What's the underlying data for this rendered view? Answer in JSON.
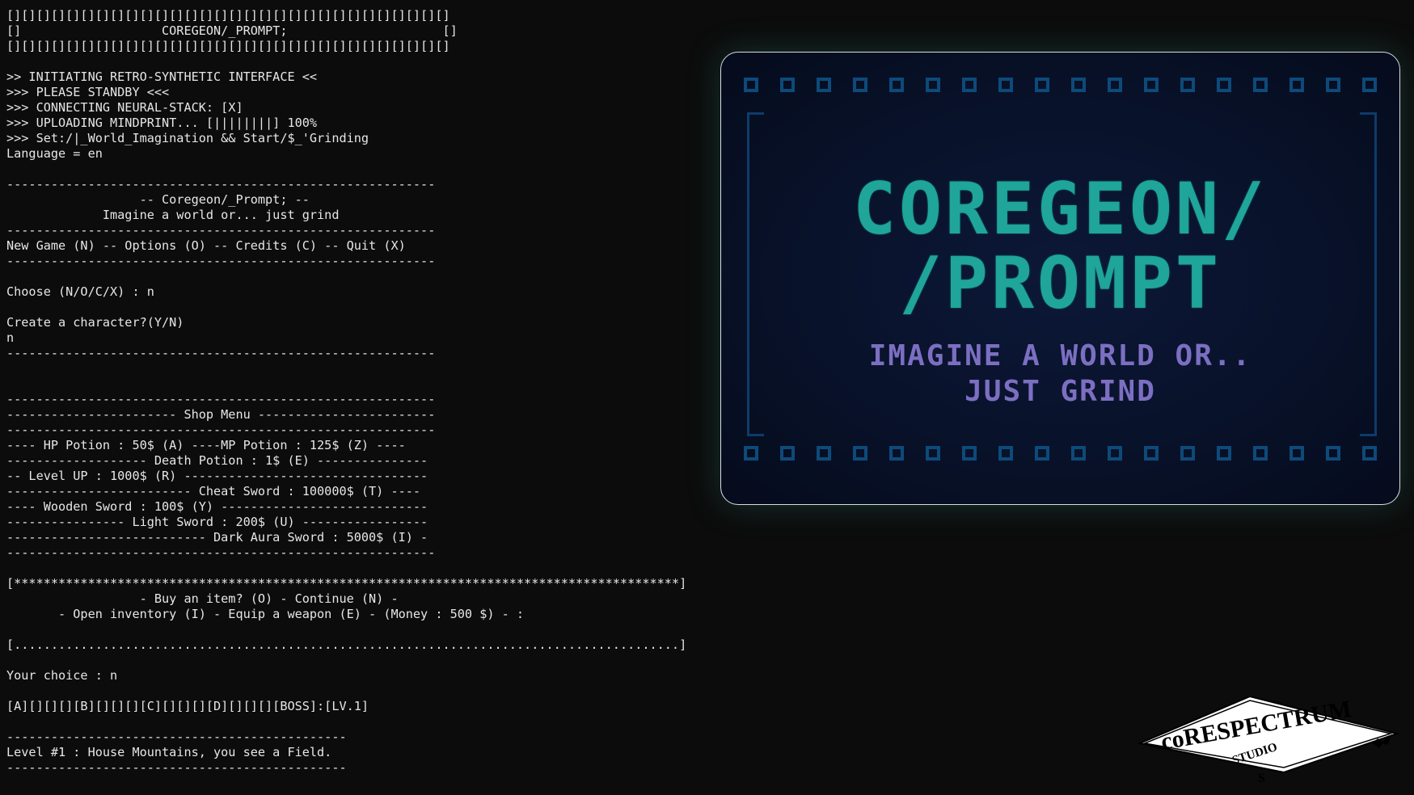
{
  "terminal": {
    "lines": [
      "[][][][][][][][][][][][][][][][][][][][][][][][][][][][][][]",
      "[]                   COREGEON/_PROMPT;                     []",
      "[][][][][][][][][][][][][][][][][][][][][][][][][][][][][][]",
      "",
      ">> INITIATING RETRO-SYNTHETIC INTERFACE <<",
      ">>> PLEASE STANDBY <<<",
      ">>> CONNECTING NEURAL-STACK: [X]",
      ">>> UPLOADING MINDPRINT... [||||||||] 100%",
      ">>> Set:/|_World_Imagination && Start/$_'Grinding",
      "Language = en",
      "",
      "----------------------------------------------------------",
      "                  -- Coregeon/_Prompt; --",
      "             Imagine a world or... just grind",
      "----------------------------------------------------------",
      "New Game (N) -- Options (O) -- Credits (C) -- Quit (X)",
      "----------------------------------------------------------",
      "",
      "Choose (N/O/C/X) : n",
      "",
      "Create a character?(Y/N)",
      "n",
      "----------------------------------------------------------",
      "",
      "",
      "----------------------------------------------------------",
      "----------------------- Shop Menu ------------------------",
      "----------------------------------------------------------",
      "---- HP Potion : 50$ (A) ----MP Potion : 125$ (Z) ----",
      "------------------- Death Potion : 1$ (E) ---------------",
      "-- Level UP : 1000$ (R) ---------------------------------",
      "------------------------- Cheat Sword : 100000$ (T) ----",
      "---- Wooden Sword : 100$ (Y) ----------------------------",
      "---------------- Light Sword : 200$ (U) -----------------",
      "--------------------------- Dark Aura Sword : 5000$ (I) -",
      "----------------------------------------------------------",
      "",
      "[******************************************************************************************]",
      "                  - Buy an item? (O) - Continue (N) -",
      "       - Open inventory (I) - Equip a weapon (E) - (Money : 500 $) - :",
      "",
      "[..........................................................................................]",
      "",
      "Your choice : n",
      "",
      "[A][][][][B][][][][C][][][][D][][][][BOSS]:[LV.1]",
      "",
      "----------------------------------------------",
      "Level #1 : House Mountains, you see a Field.",
      "----------------------------------------------"
    ]
  },
  "title_card": {
    "title_line1": "COREGEON/",
    "title_line2": "/PROMPT",
    "subtitle_line1": "IMAGINE A WORLD  OR..",
    "subtitle_line2": "JUST GRIND",
    "title_color": "#1fa59a",
    "subtitle_color": "#7c6fc2",
    "frame_color": "#0d4a7a"
  },
  "studio_logo": {
    "name": "coRESPECTRUM",
    "studio": "STUDIO",
    "mark": "S"
  }
}
